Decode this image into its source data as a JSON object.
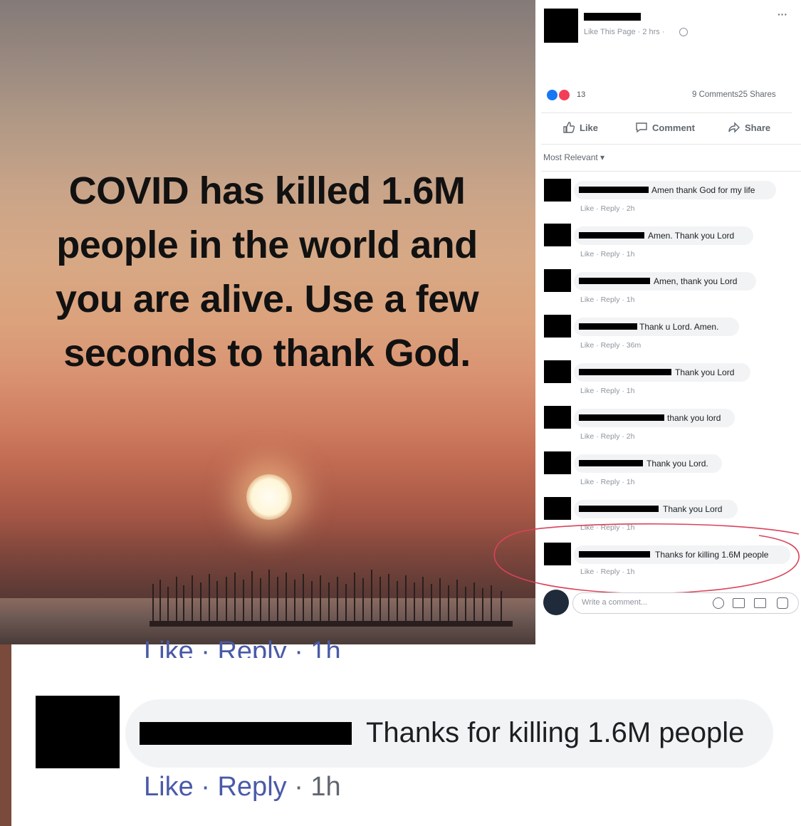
{
  "post_image": {
    "headline": "COVID has killed 1.6M people in the world and you are alive. Use a few seconds to thank God."
  },
  "fb_post": {
    "meta": "Like This Page · 2 hrs ·",
    "more": "···",
    "reaction_count": "13",
    "comments_shares": "9 Comments25 Shares",
    "actions": {
      "like": "Like",
      "comment": "Comment",
      "share": "Share"
    },
    "sort_label": "Most Relevant ▾",
    "comments": [
      {
        "text": "Amen thank God for my life",
        "actions": "Like · Reply · 2h"
      },
      {
        "text": "Amen. Thank you Lord",
        "actions": "Like · Reply · 1h"
      },
      {
        "text": "Amen, thank you Lord",
        "actions": "Like · Reply · 1h"
      },
      {
        "text": "Thank u Lord. Amen.",
        "actions": "Like · Reply · 36m"
      },
      {
        "text": "Thank you Lord",
        "actions": "Like · Reply · 1h"
      },
      {
        "text": "thank you lord",
        "actions": "Like · Reply · 2h"
      },
      {
        "text": "Thank you Lord.",
        "actions": "Like · Reply · 1h"
      },
      {
        "text": "Thank you Lord",
        "actions": "Like · Reply · 1h"
      },
      {
        "text": "Thanks for killing 1.6M people",
        "actions": "Like · Reply · 1h"
      }
    ],
    "composer_placeholder": "Write a comment..."
  },
  "zoomed_comment": {
    "actions_top": "Like · Reply · 1h",
    "text": "Thanks for killing 1.6M people",
    "actions_link": "Like · Reply",
    "time": " · 1h"
  },
  "colors": {
    "highlight_circle": "#d9435a",
    "link": "#4a5aa8",
    "fb_blue": "#1877f2"
  }
}
